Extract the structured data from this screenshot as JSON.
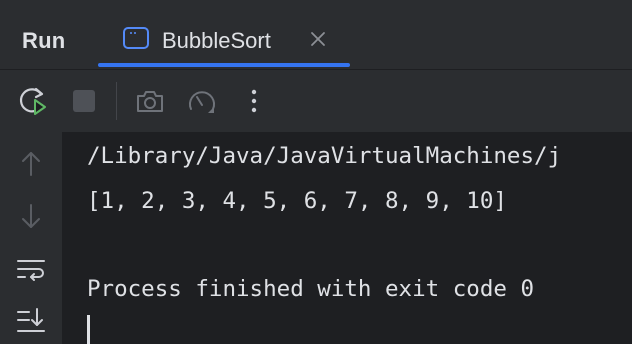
{
  "panel": {
    "title": "Run"
  },
  "tab": {
    "label": "BubbleSort",
    "icon": "window-icon",
    "close_icon": "close-icon"
  },
  "toolbar": {
    "buttons": [
      {
        "name": "rerun-icon"
      },
      {
        "name": "stop-icon"
      },
      {
        "name": "camera-icon"
      },
      {
        "name": "gauge-icon"
      },
      {
        "name": "more-vertical-icon"
      }
    ]
  },
  "gutter": {
    "buttons": [
      {
        "name": "arrow-up-icon"
      },
      {
        "name": "arrow-down-icon"
      },
      {
        "name": "soft-wrap-icon"
      },
      {
        "name": "scroll-to-end-icon"
      }
    ]
  },
  "console": {
    "lines": [
      "/Library/Java/JavaVirtualMachines/j",
      "[1, 2, 3, 4, 5, 6, 7, 8, 9, 10]",
      "",
      "Process finished with exit code 0"
    ]
  },
  "colors": {
    "background": "#1e1f22",
    "panel": "#2b2d30",
    "text": "#dfe1e5",
    "accent": "#3574f0",
    "run_green": "#5fb865",
    "icon_muted": "#6f737a"
  }
}
